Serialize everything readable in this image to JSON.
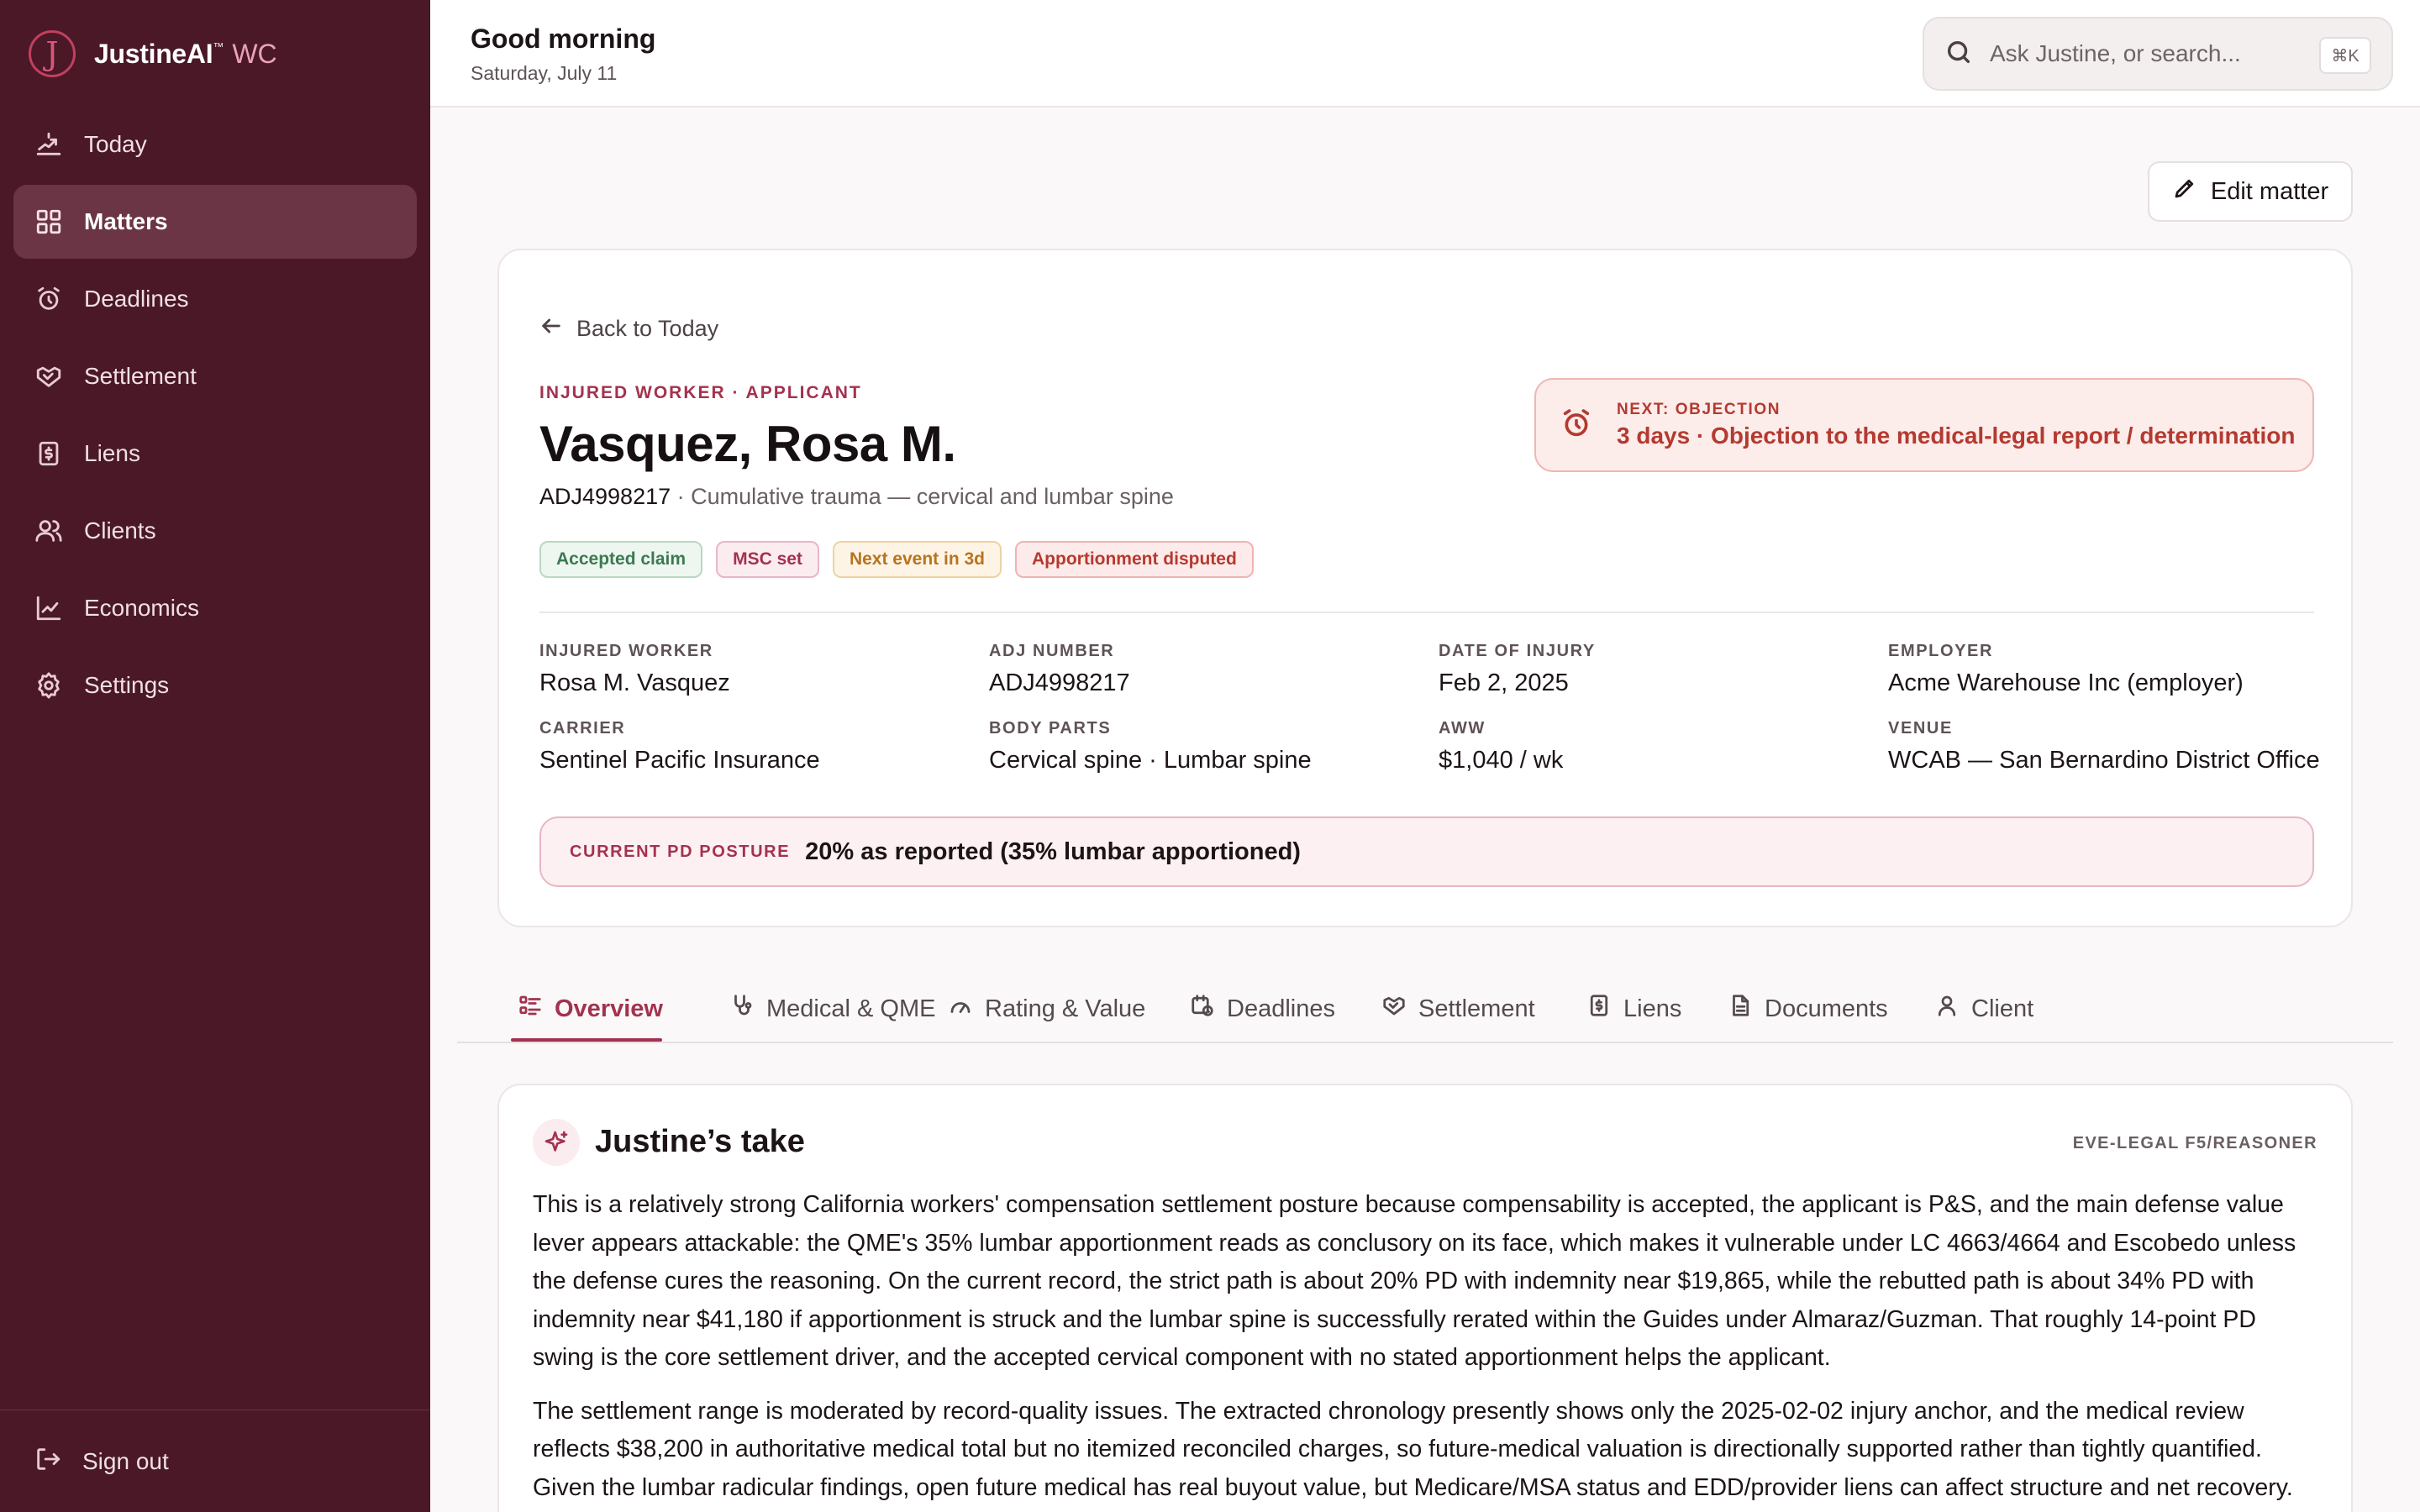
{
  "brand": {
    "logo_glyph": "J",
    "name": "JustineAI",
    "tm": "™",
    "sub": "WC"
  },
  "nav": {
    "items": [
      {
        "label": "Today",
        "icon": "chart-up-icon"
      },
      {
        "label": "Matters",
        "icon": "grid-icon",
        "active": true
      },
      {
        "label": "Deadlines",
        "icon": "alarm-clock-icon"
      },
      {
        "label": "Settlement",
        "icon": "handshake-icon"
      },
      {
        "label": "Liens",
        "icon": "dollar-doc-icon"
      },
      {
        "label": "Clients",
        "icon": "users-icon"
      },
      {
        "label": "Economics",
        "icon": "line-chart-icon"
      },
      {
        "label": "Settings",
        "icon": "gear-icon"
      }
    ],
    "signout": "Sign out"
  },
  "header": {
    "greeting": "Good morning",
    "date": "Saturday, July 11",
    "search_placeholder": "Ask Justine, or search...",
    "shortcut": "⌘K"
  },
  "edit_button": "Edit matter",
  "matter": {
    "back": "Back to Today",
    "eyebrow": "INJURED WORKER · APPLICANT",
    "name": "Vasquez, Rosa M.",
    "adj": "ADJ4998217",
    "separator": " · ",
    "description": "Cumulative trauma — cervical and lumbar spine",
    "badges": [
      {
        "label": "Accepted claim",
        "tone": "green"
      },
      {
        "label": "MSC set",
        "tone": "rose"
      },
      {
        "label": "Next event in 3d",
        "tone": "amber"
      },
      {
        "label": "Apportionment disputed",
        "tone": "red"
      }
    ],
    "alert": {
      "label": "NEXT: OBJECTION",
      "value": "3 days · Objection to the medical-legal report / determination"
    },
    "facts": {
      "injured_worker": {
        "label": "INJURED WORKER",
        "value": "Rosa M. Vasquez"
      },
      "adj_number": {
        "label": "ADJ NUMBER",
        "value": "ADJ4998217"
      },
      "date_of_injury": {
        "label": "DATE OF INJURY",
        "value": "Feb 2, 2025"
      },
      "employer": {
        "label": "EMPLOYER",
        "value": "Acme Warehouse Inc (employer)"
      },
      "carrier": {
        "label": "CARRIER",
        "value": "Sentinel Pacific Insurance"
      },
      "body_parts": {
        "label": "BODY PARTS",
        "value": "Cervical spine · Lumbar spine"
      },
      "aww": {
        "label": "AWW",
        "value": "$1,040 / wk"
      },
      "venue": {
        "label": "VENUE",
        "value": "WCAB — San Bernardino District Office"
      }
    },
    "posture": {
      "label": "CURRENT PD POSTURE",
      "value": "20% as reported (35% lumbar apportioned)"
    }
  },
  "tabs": [
    {
      "label": "Overview",
      "icon": "list-icon",
      "active": true
    },
    {
      "label": "Medical & QME",
      "icon": "stethoscope-icon"
    },
    {
      "label": "Rating & Value",
      "icon": "gauge-icon"
    },
    {
      "label": "Deadlines",
      "icon": "calendar-clock-icon"
    },
    {
      "label": "Settlement",
      "icon": "handshake-icon"
    },
    {
      "label": "Liens",
      "icon": "dollar-doc-icon"
    },
    {
      "label": "Documents",
      "icon": "document-icon"
    },
    {
      "label": "Client",
      "icon": "user-icon"
    }
  ],
  "take": {
    "title": "Justine’s take",
    "model": "EVE-LEGAL F5/REASONER",
    "paragraphs": [
      "This is a relatively strong California workers' compensation settlement posture because compensability is accepted, the applicant is P&S, and the main defense value lever appears attackable: the QME's 35% lumbar apportionment reads as conclusory on its face, which makes it vulnerable under LC 4663/4664 and Escobedo unless the defense cures the reasoning. On the current record, the strict path is about 20% PD with indemnity near $19,865, while the rebutted path is about 34% PD with indemnity near $41,180 if apportionment is struck and the lumbar spine is successfully rerated within the Guides under Almaraz/Guzman. That roughly 14-point PD swing is the core settlement driver, and the accepted cervical component with no stated apportionment helps the applicant.",
      "The settlement range is moderated by record-quality issues. The extracted chronology presently shows only the 2025-02-02 injury anchor, and the medical review reflects $38,200 in authoritative medical total but no itemized reconciled charges, so future-medical valuation is directionally supported rather than tightly quantified. Given the lumbar radicular findings, open future medical has real buyout value, but Medicare/MSA status and EDD/provider liens can affect structure and net recovery."
    ]
  }
}
